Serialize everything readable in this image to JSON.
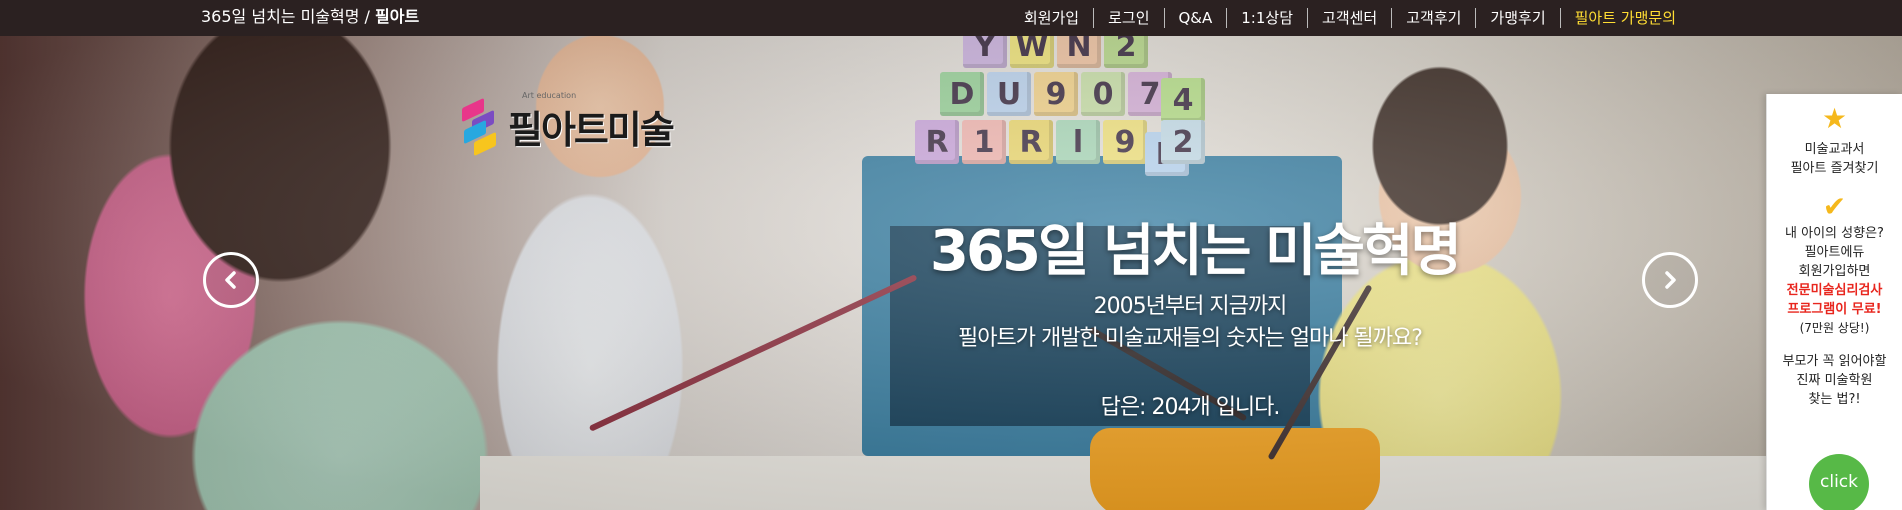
{
  "topbar": {
    "tagline_prefix": "365일 넘치는 미술혁명 / ",
    "tagline_brand": "필아트",
    "nav": [
      {
        "label": "회원가입"
      },
      {
        "label": "로그인"
      },
      {
        "label": "Q&A"
      },
      {
        "label": "1:1상담"
      },
      {
        "label": "고객센터"
      },
      {
        "label": "고객후기"
      },
      {
        "label": "가맹후기"
      },
      {
        "label": "필아트 가맹문의",
        "highlight": true
      }
    ]
  },
  "logo": {
    "text": "필아트미술",
    "subtext": "Art education"
  },
  "hero": {
    "blocks": [
      "Y",
      "W",
      "N",
      "2",
      "D",
      "U",
      "9",
      "0",
      "7",
      "4",
      "R",
      "1",
      "R",
      "l",
      "9",
      "B",
      "2"
    ],
    "title": "365일 넘치는 미술혁명",
    "subtitle_line1": "2005년부터 지금까지",
    "subtitle_line2": "필아트가 개발한 미술교재들의 숫자는 얼마나 될까요?",
    "answer": "답은: 204개 입니다."
  },
  "side_panel": {
    "fav_line1": "미술교과서",
    "fav_line2": "필아트 즐겨찾기",
    "q_line1": "내 아이의 성향은?",
    "q_line2": "필아트에듀",
    "q_line3": "회원가입하면",
    "red_line1": "전문미술심리검사",
    "red_line2": "프로그램이 무료!",
    "price_note": "(7만원 상당!)",
    "book_line1": "부모가 꼭 읽어야할",
    "book_line2": "진짜 미술학원",
    "book_line3": "찾는 법?!",
    "click_label": "click"
  },
  "colors": {
    "topbar_bg": "#2b2121",
    "highlight": "#ffdd33",
    "accent_red": "#e8261e",
    "click_green": "#57b947",
    "star_yellow": "#f5b81c"
  }
}
